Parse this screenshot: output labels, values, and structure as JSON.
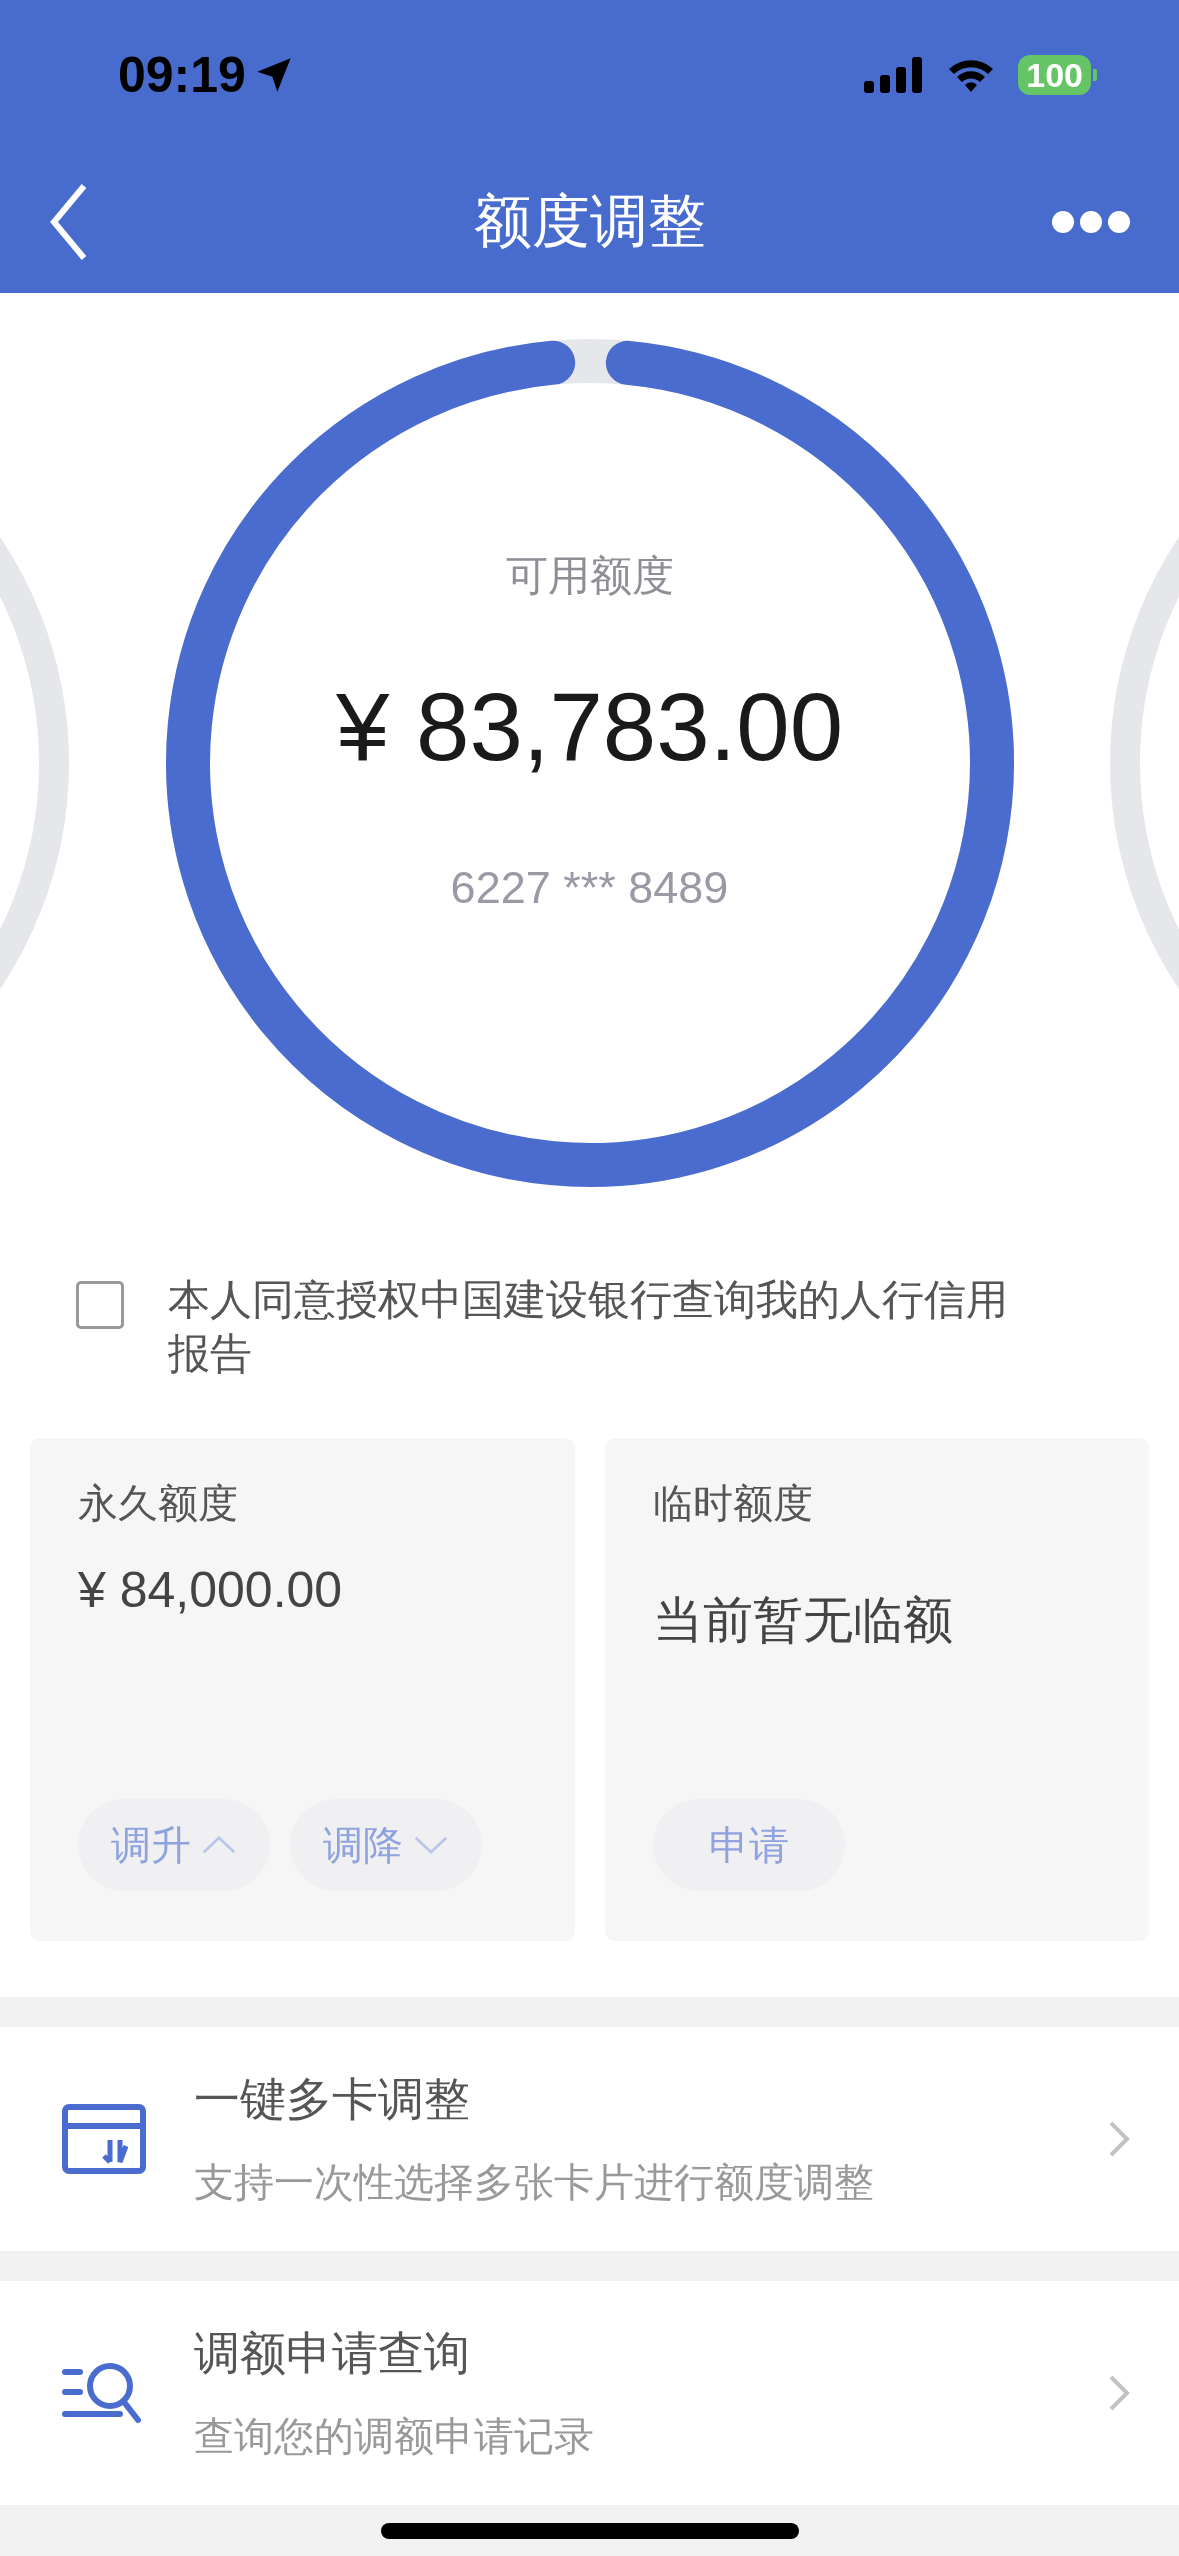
{
  "status_bar": {
    "time": "09:19",
    "battery": "100"
  },
  "nav": {
    "title": "额度调整"
  },
  "balance": {
    "label": "可用额度",
    "amount": "¥ 83,783.00",
    "card_number": "6227 *** 8489",
    "level": 0.97
  },
  "consent": {
    "text": "本人同意授权中国建设银行查询我的人行信用报告",
    "checked": false
  },
  "limit_cards": [
    {
      "title": "永久额度",
      "value": "¥  84,000.00",
      "kind": "amount",
      "actions": [
        {
          "label": "调升",
          "kind": "up"
        },
        {
          "label": "调降",
          "kind": "down"
        }
      ]
    },
    {
      "title": "临时额度",
      "value": "当前暂无临额",
      "kind": "note",
      "actions": [
        {
          "label": "申请",
          "kind": "plain"
        }
      ]
    }
  ],
  "menu": [
    {
      "kind": "cards",
      "title": "一键多卡调整",
      "subtitle": "支持一次性选择多张卡片进行额度调整"
    },
    {
      "kind": "search",
      "title": "调额申请查询",
      "subtitle": "查询您的调额申请记录"
    }
  ]
}
